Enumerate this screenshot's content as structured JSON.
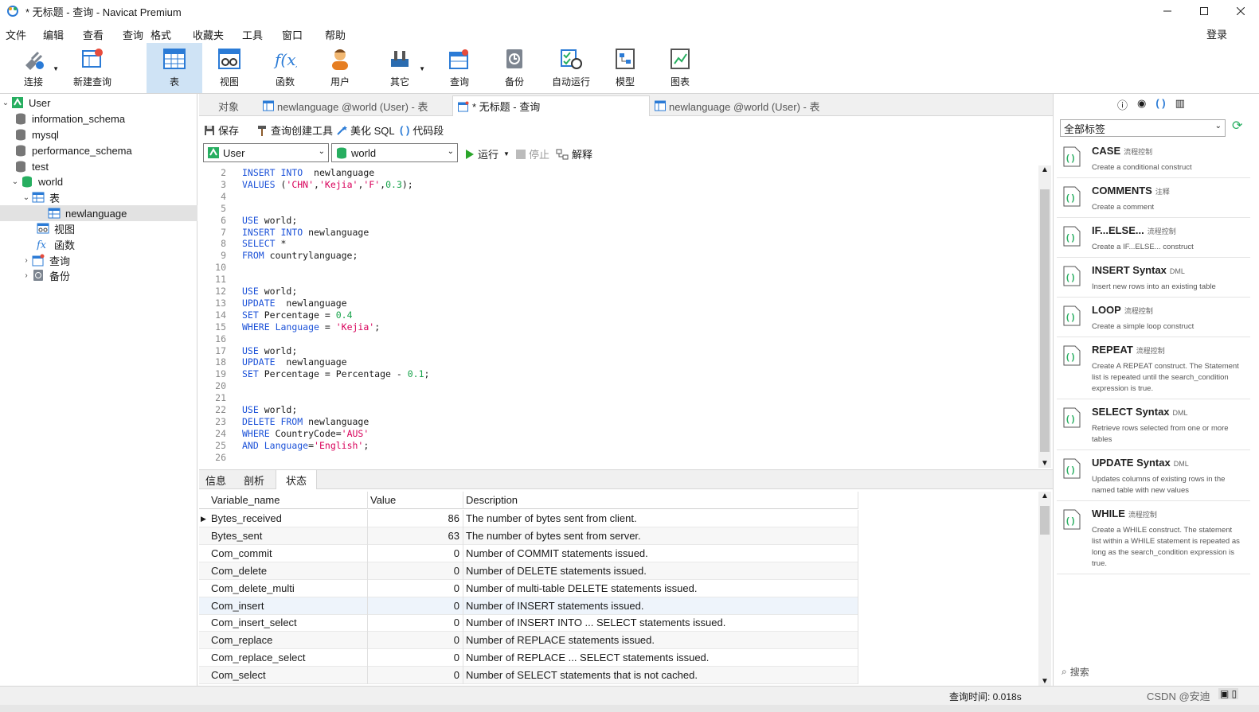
{
  "window": {
    "title": "* 无标题 - 查询 - Navicat Premium"
  },
  "menu": [
    "文件",
    "编辑",
    "查看",
    "查询",
    "格式",
    "收藏夹",
    "工具",
    "窗口",
    "帮助"
  ],
  "account": {
    "login_label": "登录"
  },
  "toolbar": [
    {
      "label": "连接",
      "icon": "plug-icon"
    },
    {
      "label": "新建查询",
      "icon": "new-query-icon"
    },
    {
      "label": "表",
      "icon": "table-icon"
    },
    {
      "label": "视图",
      "icon": "view-icon"
    },
    {
      "label": "函数",
      "icon": "function-icon"
    },
    {
      "label": "用户",
      "icon": "user-icon"
    },
    {
      "label": "其它",
      "icon": "tools-icon"
    },
    {
      "label": "查询",
      "icon": "query-icon"
    },
    {
      "label": "备份",
      "icon": "backup-icon"
    },
    {
      "label": "自动运行",
      "icon": "schedule-icon"
    },
    {
      "label": "模型",
      "icon": "model-icon"
    },
    {
      "label": "图表",
      "icon": "chart-icon"
    }
  ],
  "navigator": {
    "items": [
      {
        "label": "User"
      },
      {
        "label": "information_schema"
      },
      {
        "label": "mysql"
      },
      {
        "label": "performance_schema"
      },
      {
        "label": "test"
      },
      {
        "label": "world"
      },
      {
        "label": "表"
      },
      {
        "label": "newlanguage"
      },
      {
        "label": "视图"
      },
      {
        "label": "函数"
      },
      {
        "label": "查询"
      },
      {
        "label": "备份"
      }
    ]
  },
  "tabs": [
    {
      "label": "对象"
    },
    {
      "label": "newlanguage @world (User) - 表"
    },
    {
      "label": "* 无标题 - 查询"
    },
    {
      "label": "newlanguage @world (User) - 表"
    }
  ],
  "editor_toolbar": {
    "save": "保存",
    "builder": "查询创建工具",
    "beautify": "美化 SQL",
    "snippet": "代码段",
    "run": "运行",
    "stop": "停止",
    "explain": "解释"
  },
  "selectors": {
    "connection": "User",
    "database": "world"
  },
  "code": [
    {
      "n": "2",
      "t": [
        [
          "kw",
          "INSERT INTO"
        ],
        [
          "",
          "  newlanguage"
        ]
      ]
    },
    {
      "n": "3",
      "t": [
        [
          "kw",
          "VALUES"
        ],
        [
          "",
          " ("
        ],
        [
          "str",
          "'CHN'"
        ],
        [
          "",
          ","
        ],
        [
          "str",
          "'Kejia'"
        ],
        [
          "",
          ","
        ],
        [
          "str",
          "'F'"
        ],
        [
          "",
          ","
        ],
        [
          "num",
          "0.3"
        ],
        [
          "",
          ");"
        ]
      ]
    },
    {
      "n": "4",
      "t": []
    },
    {
      "n": "5",
      "t": []
    },
    {
      "n": "6",
      "t": [
        [
          "kw",
          "USE"
        ],
        [
          "",
          "",
          " world;"
        ]
      ]
    },
    {
      "n": "7",
      "t": [
        [
          "kw",
          "INSERT INTO"
        ],
        [
          "",
          " newlanguage"
        ]
      ]
    },
    {
      "n": "8",
      "t": [
        [
          "kw",
          "SELECT"
        ],
        [
          "",
          " *"
        ]
      ]
    },
    {
      "n": "9",
      "t": [
        [
          "kw",
          "FROM"
        ],
        [
          "",
          " countrylanguage;"
        ]
      ]
    },
    {
      "n": "10",
      "t": []
    },
    {
      "n": "11",
      "t": []
    },
    {
      "n": "12",
      "t": [
        [
          "kw",
          "USE"
        ],
        [
          "",
          " world;"
        ]
      ]
    },
    {
      "n": "13",
      "t": [
        [
          "kw",
          "UPDATE"
        ],
        [
          "",
          "  newlanguage"
        ]
      ]
    },
    {
      "n": "14",
      "t": [
        [
          "kw",
          "SET"
        ],
        [
          "",
          " Percentage = "
        ],
        [
          "num",
          "0.4"
        ]
      ]
    },
    {
      "n": "15",
      "t": [
        [
          "kw",
          "WHERE"
        ],
        [
          "",
          " "
        ],
        [
          "kw",
          "Language"
        ],
        [
          "",
          " = "
        ],
        [
          "str",
          "'Kejia'"
        ],
        [
          "",
          ";"
        ]
      ]
    },
    {
      "n": "16",
      "t": []
    },
    {
      "n": "17",
      "t": [
        [
          "kw",
          "USE"
        ],
        [
          "",
          " world;"
        ]
      ]
    },
    {
      "n": "18",
      "t": [
        [
          "kw",
          "UPDATE"
        ],
        [
          "",
          "  newlanguage"
        ]
      ]
    },
    {
      "n": "19",
      "t": [
        [
          "kw",
          "SET"
        ],
        [
          "",
          " Percentage = Percentage - "
        ],
        [
          "num",
          "0.1"
        ],
        [
          "",
          ";"
        ]
      ]
    },
    {
      "n": "20",
      "t": []
    },
    {
      "n": "21",
      "t": []
    },
    {
      "n": "22",
      "t": [
        [
          "kw",
          "USE"
        ],
        [
          "",
          " world;"
        ]
      ]
    },
    {
      "n": "23",
      "t": [
        [
          "kw",
          "DELETE FROM"
        ],
        [
          "",
          " newlanguage"
        ]
      ]
    },
    {
      "n": "24",
      "t": [
        [
          "kw",
          "WHERE"
        ],
        [
          "",
          " CountryCode="
        ],
        [
          "str",
          "'AUS'"
        ]
      ]
    },
    {
      "n": "25",
      "t": [
        [
          "kw",
          "AND"
        ],
        [
          "",
          " "
        ],
        [
          "kw",
          "Language"
        ],
        [
          "",
          "="
        ],
        [
          "str",
          "'English'"
        ],
        [
          "",
          ";"
        ]
      ]
    },
    {
      "n": "26",
      "t": []
    }
  ],
  "bottom_tabs": [
    "信息",
    "剖析",
    "状态"
  ],
  "status_table": {
    "columns": [
      "Variable_name",
      "Value",
      "Description"
    ],
    "rows": [
      [
        "Bytes_received",
        "86",
        "The number of bytes sent from client."
      ],
      [
        "Bytes_sent",
        "63",
        "The number of bytes sent from server."
      ],
      [
        "Com_commit",
        "0",
        "Number of COMMIT statements issued."
      ],
      [
        "Com_delete",
        "0",
        "Number of DELETE statements issued."
      ],
      [
        "Com_delete_multi",
        "0",
        "Number of multi-table DELETE statements issued."
      ],
      [
        "Com_insert",
        "0",
        "Number of INSERT statements issued."
      ],
      [
        "Com_insert_select",
        "0",
        "Number of INSERT INTO ... SELECT statements issued."
      ],
      [
        "Com_replace",
        "0",
        "Number of REPLACE statements issued."
      ],
      [
        "Com_replace_select",
        "0",
        "Number of REPLACE ... SELECT statements issued."
      ],
      [
        "Com_select",
        "0",
        "Number of SELECT statements that is not cached."
      ]
    ]
  },
  "snippets": {
    "filter": "全部标签",
    "search_placeholder": "搜索",
    "items": [
      {
        "name": "CASE",
        "cat": "流程控制",
        "desc": "Create a conditional construct"
      },
      {
        "name": "COMMENTS",
        "cat": "注释",
        "desc": "Create a comment"
      },
      {
        "name": "IF...ELSE...",
        "cat": "流程控制",
        "desc": "Create a IF...ELSE... construct"
      },
      {
        "name": "INSERT Syntax",
        "cat": "DML",
        "desc": "Insert new rows into an existing table"
      },
      {
        "name": "LOOP",
        "cat": "流程控制",
        "desc": "Create a simple loop construct"
      },
      {
        "name": "REPEAT",
        "cat": "流程控制",
        "desc": "Create A REPEAT construct. The Statement list is repeated until the search_condition expression is true."
      },
      {
        "name": "SELECT Syntax",
        "cat": "DML",
        "desc": "Retrieve rows selected from one or more tables"
      },
      {
        "name": "UPDATE Syntax",
        "cat": "DML",
        "desc": "Updates columns of existing rows in the named table with new values"
      },
      {
        "name": "WHILE",
        "cat": "流程控制",
        "desc": "Create a WHILE construct. The statement list within a WHILE statement is repeated as long as the search_condition expression is true."
      }
    ]
  },
  "statusbar": {
    "query_time": "查询时间: 0.018s",
    "watermark": "CSDN @安迪"
  },
  "colors": {
    "accent": "#1c52d8",
    "string": "#d8005a",
    "number": "#17a34a",
    "active_tool": "#cfe3f5",
    "run_green": "#2aa52a"
  }
}
